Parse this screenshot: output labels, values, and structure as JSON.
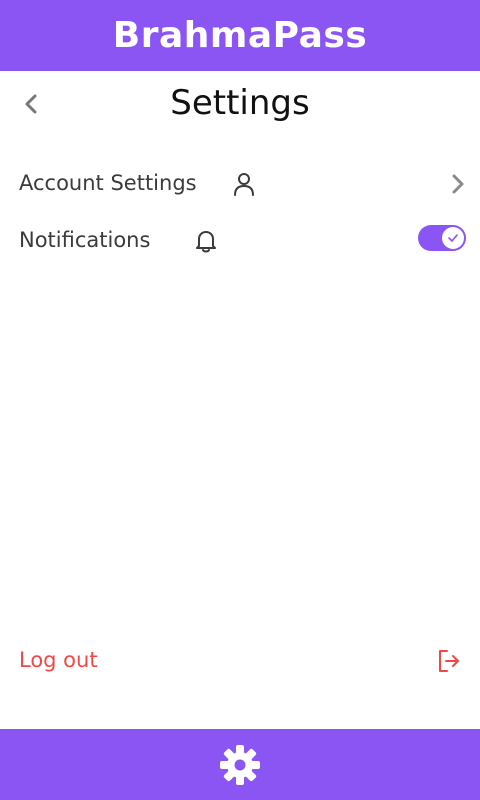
{
  "app": {
    "title": "BrahmaPass"
  },
  "header": {
    "title": "Settings"
  },
  "settings": {
    "items": [
      {
        "label": "Account Settings",
        "icon": "user-icon",
        "action": "chevron-right-icon"
      },
      {
        "label": "Notifications",
        "icon": "bell-icon",
        "toggle_on": true
      }
    ]
  },
  "logout": {
    "label": "Log out",
    "icon": "logout-icon"
  },
  "colors": {
    "accent": "#8b55f4",
    "danger": "#f04848",
    "text": "#3b3b3b"
  },
  "bottom_nav": {
    "icon": "gear-icon"
  }
}
